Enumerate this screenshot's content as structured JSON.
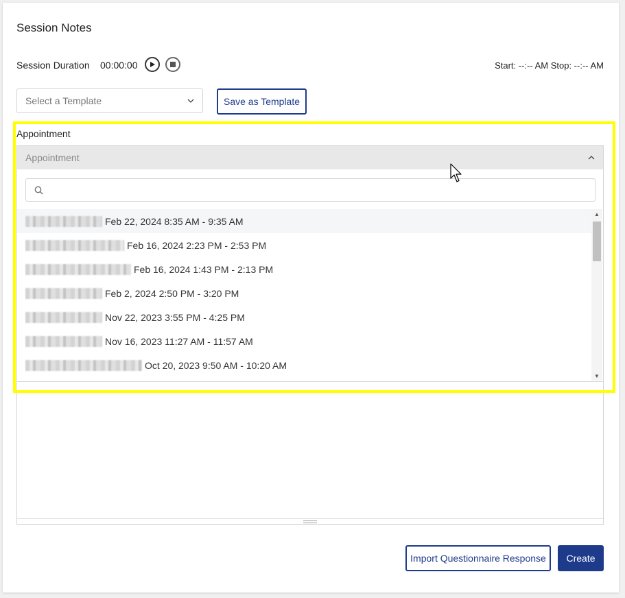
{
  "page": {
    "title": "Session Notes",
    "duration_label": "Session Duration",
    "duration_value": "00:00:00",
    "start_stop_text": "Start: --:-- AM Stop: --:-- AM"
  },
  "template": {
    "select_placeholder": "Select a Template",
    "save_label": "Save as Template"
  },
  "appointment": {
    "label": "Appointment",
    "dropdown_placeholder": "Appointment",
    "search_placeholder": "",
    "items": [
      {
        "name_blur_width": 112,
        "time": "Feb 22, 2024 8:35 AM - 9:35 AM"
      },
      {
        "name_blur_width": 144,
        "time": "Feb 16, 2024 2:23 PM - 2:53 PM"
      },
      {
        "name_blur_width": 154,
        "time": "Feb 16, 2024 1:43 PM - 2:13 PM"
      },
      {
        "name_blur_width": 112,
        "time": "Feb 2, 2024 2:50 PM - 3:20 PM"
      },
      {
        "name_blur_width": 112,
        "time": "Nov 22, 2023 3:55 PM - 4:25 PM"
      },
      {
        "name_blur_width": 112,
        "time": "Nov 16, 2023 11:27 AM - 11:57 AM"
      },
      {
        "name_blur_width": 170,
        "time": "Oct 20, 2023 9:50 AM - 10:20 AM"
      }
    ]
  },
  "actions": {
    "import_label": "Import Questionnaire Response",
    "create_label": "Create"
  },
  "colors": {
    "primary": "#1e3a8a",
    "highlight": "#ffff00"
  }
}
